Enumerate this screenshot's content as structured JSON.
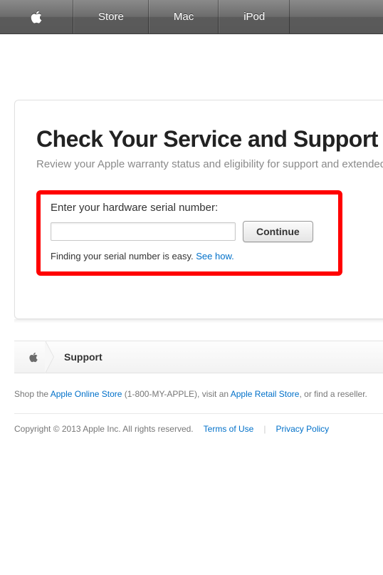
{
  "nav": {
    "items": [
      "Store",
      "Mac",
      "iPod"
    ]
  },
  "card": {
    "heading": "Check Your Service and Support Coverage",
    "subheading": "Review your Apple warranty status and eligibility for support and extended coverage.",
    "form": {
      "label": "Enter your hardware serial number:",
      "input_value": "",
      "input_placeholder": "",
      "button": "Continue",
      "help_text": "Finding your serial number is easy. ",
      "help_link": "See how."
    }
  },
  "breadcrumb": {
    "label": "Support"
  },
  "footer": {
    "shop_prefix": "Shop the ",
    "shop_link1": "Apple Online Store",
    "shop_phone": " (1-800-MY-APPLE), visit an ",
    "shop_link2": "Apple Retail Store",
    "shop_suffix": ", or find a reseller.",
    "copyright": "Copyright © 2013 Apple Inc. All rights reserved.",
    "terms": "Terms of Use",
    "privacy": "Privacy Policy"
  }
}
